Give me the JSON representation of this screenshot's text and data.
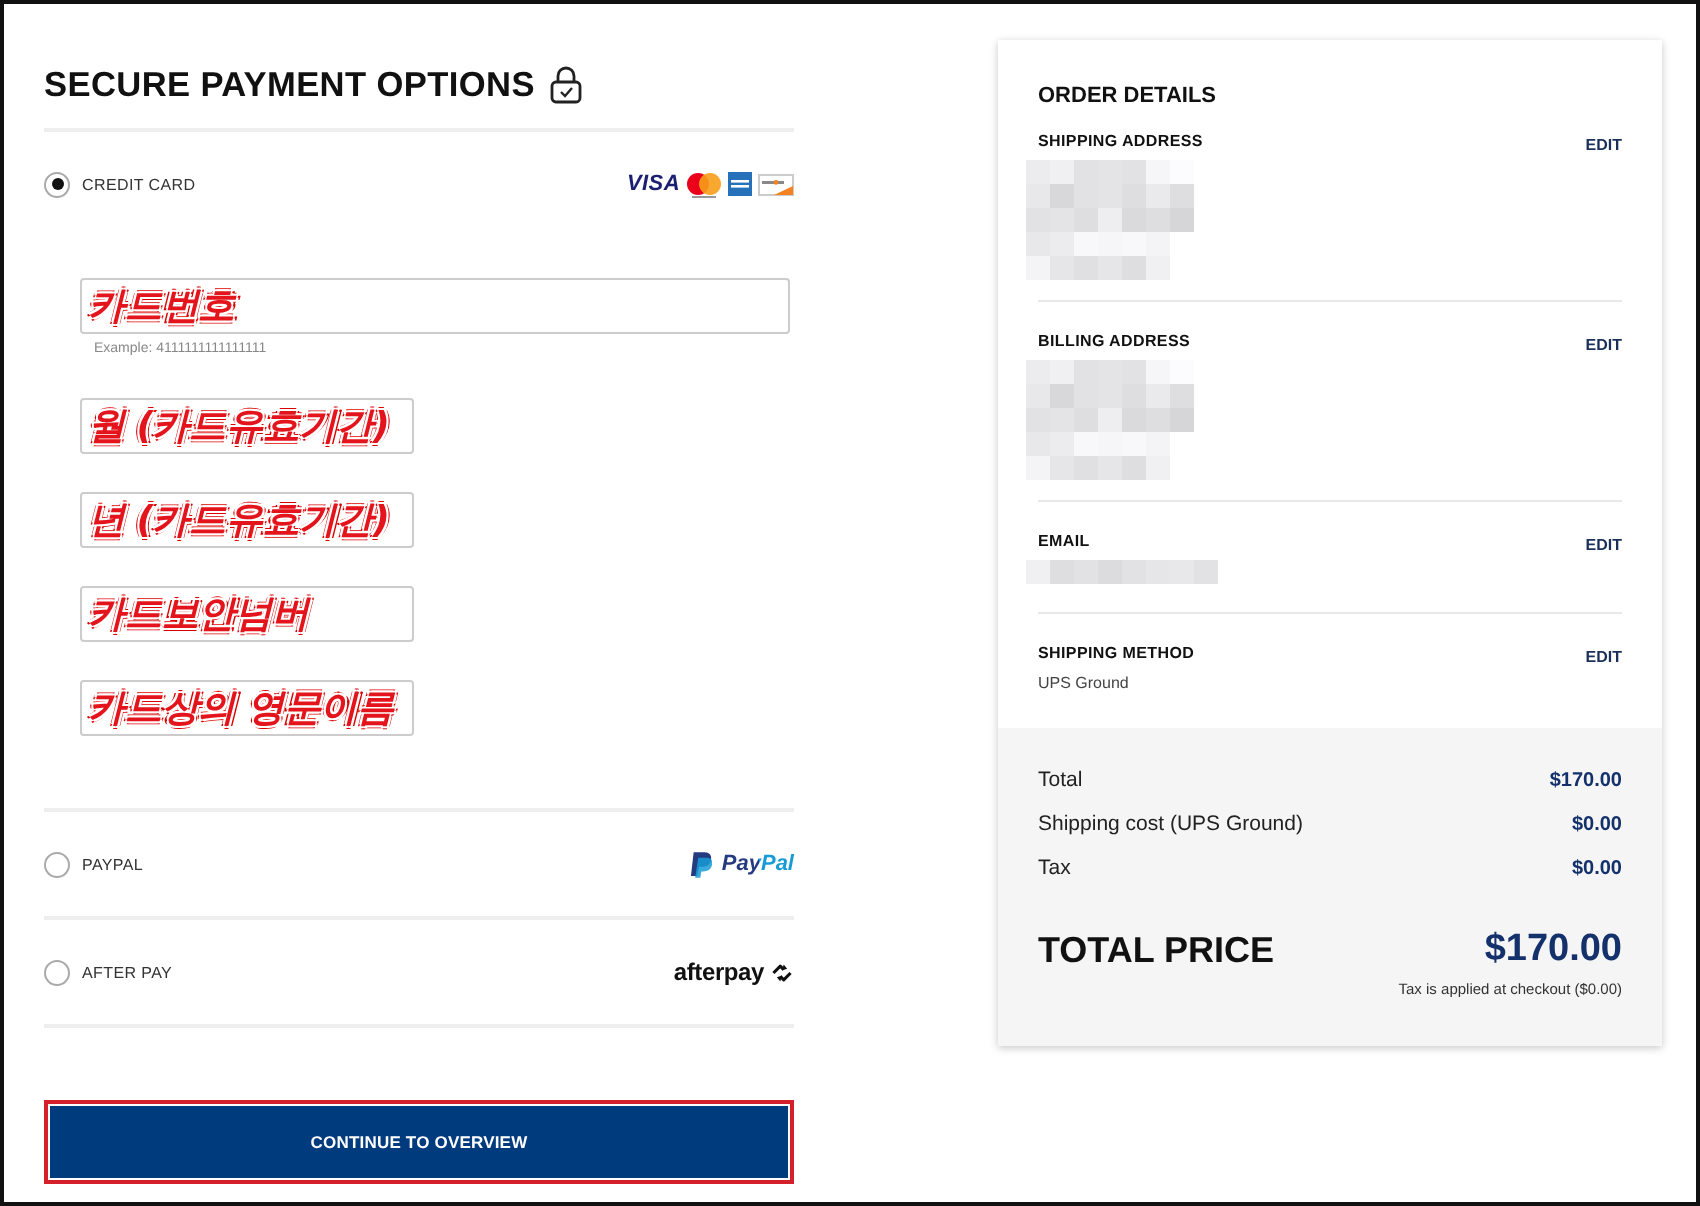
{
  "payment": {
    "title": "SECURE PAYMENT OPTIONS",
    "options": [
      {
        "kind": "card",
        "label": "CREDIT CARD",
        "selected": true,
        "logo_text": "VISA"
      },
      {
        "kind": "paypal",
        "label": "PAYPAL",
        "selected": false,
        "logo_text": "PayPal"
      },
      {
        "kind": "afterpay",
        "label": "AFTER PAY",
        "selected": false,
        "logo_text": "afterpay"
      }
    ],
    "card_fields": [
      {
        "kind": "card_number",
        "annotation": "카드번호",
        "hint": "Example: 4111111111111111"
      },
      {
        "kind": "month",
        "annotation": "월 (카드유효기간)"
      },
      {
        "kind": "year",
        "annotation": "년 (카드유효기간)"
      },
      {
        "kind": "cvv",
        "annotation": "카드보안넘버"
      },
      {
        "kind": "name",
        "annotation": "카드상의 영문이름"
      }
    ],
    "continue_button": {
      "label": "CONTINUE TO OVERVIEW",
      "highlighted": true
    }
  },
  "order_details": {
    "title": "ORDER DETAILS",
    "sections": [
      {
        "kind": "redacted_block",
        "label": "SHIPPING ADDRESS",
        "edit": "EDIT"
      },
      {
        "kind": "redacted_block",
        "label": "BILLING ADDRESS",
        "edit": "EDIT"
      },
      {
        "kind": "redacted_line",
        "label": "EMAIL",
        "edit": "EDIT"
      },
      {
        "kind": "text",
        "label": "SHIPPING METHOD",
        "value": "UPS Ground",
        "edit": "EDIT"
      }
    ],
    "summary": [
      {
        "label": "Total",
        "amount": "$170.00"
      },
      {
        "label": "Shipping cost (UPS Ground)",
        "amount": "$0.00"
      },
      {
        "label": "Tax",
        "amount": "$0.00"
      }
    ],
    "total": {
      "label": "TOTAL PRICE",
      "amount": "$170.00",
      "note": "Tax is applied at checkout ($0.00)"
    }
  }
}
